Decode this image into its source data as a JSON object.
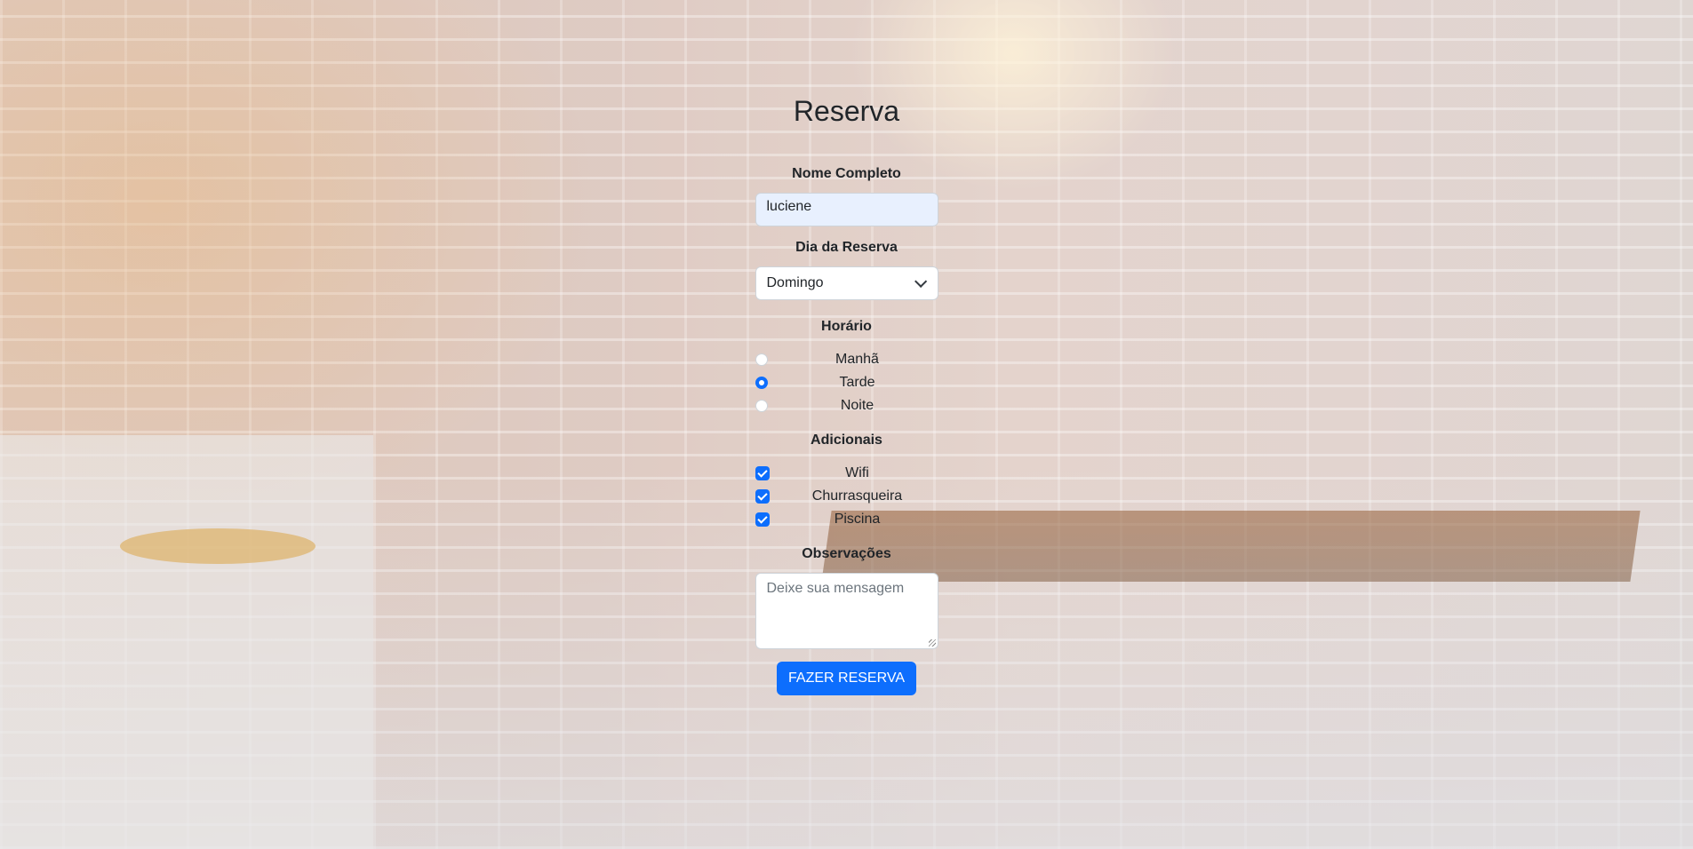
{
  "page": {
    "title": "Reserva"
  },
  "form": {
    "name_label": "Nome Completo",
    "name_value": "luciene",
    "day_label": "Dia da Reserva",
    "day_selected": "Domingo",
    "time_label": "Horário",
    "time_options": [
      {
        "label": "Manhã",
        "checked": false
      },
      {
        "label": "Tarde",
        "checked": true
      },
      {
        "label": "Noite",
        "checked": false
      }
    ],
    "extras_label": "Adicionais",
    "extras_options": [
      {
        "label": "Wifi",
        "checked": true
      },
      {
        "label": "Churrasqueira",
        "checked": true
      },
      {
        "label": "Piscina",
        "checked": true
      }
    ],
    "notes_label": "Observações",
    "notes_placeholder": "Deixe sua mensagem",
    "submit_label": "FAZER RESERVA"
  },
  "colors": {
    "accent": "#0d6efd",
    "autofill_bg": "#e8f0fe"
  },
  "icons": {
    "select_arrow": "chevron-down-icon",
    "check": "check-icon"
  }
}
